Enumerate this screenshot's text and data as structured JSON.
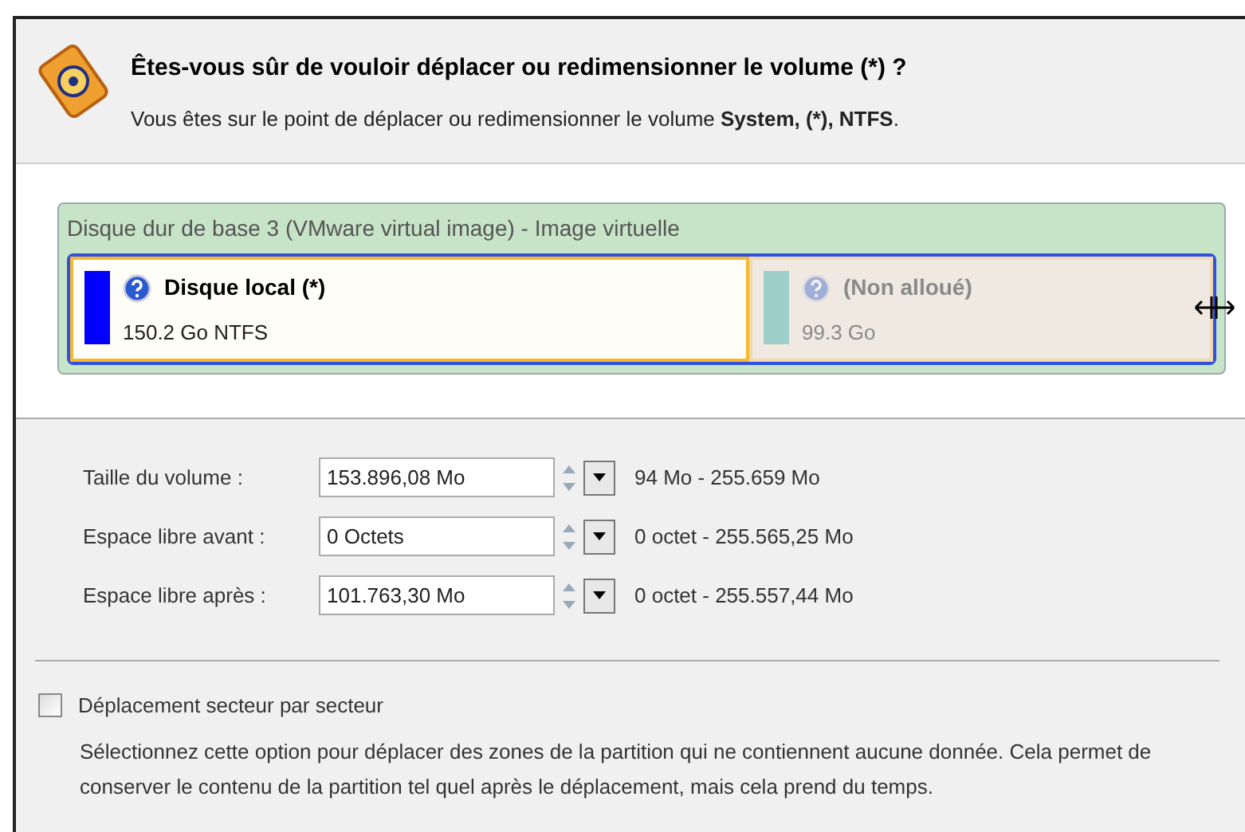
{
  "header": {
    "title": "Êtes-vous sûr de vouloir déplacer ou redimensionner le volume (*) ?",
    "subtitle": "Vous êtes sur le point de déplacer ou redimensionner le volume **System, (*), NTFS**."
  },
  "disk": {
    "title": "Disque dur de base 3 (VMware virtual image) - Image virtuelle",
    "partitions": [
      {
        "name": "Disque local (*)",
        "info": "150.2 Go NTFS",
        "color": "#0000ff",
        "kind": "volume",
        "selected": true
      },
      {
        "name": "(Non alloué)",
        "info": "99.3 Go",
        "color": "#9ecfc8",
        "kind": "unallocated",
        "selected": false
      }
    ]
  },
  "fields": [
    {
      "label": "Taille du volume :",
      "value": "153.896,08 Mo",
      "range": "94 Mo - 255.659 Mo"
    },
    {
      "label": "Espace libre avant :",
      "value": "0 Octets",
      "range": "0 octet - 255.565,25 Mo"
    },
    {
      "label": "Espace libre après :",
      "value": "101.763,30 Mo",
      "range": "0 octet - 255.557,44 Mo"
    }
  ],
  "option": {
    "label": "Déplacement secteur par secteur",
    "checked": false,
    "description": "Sélectionnez cette option pour déplacer des zones de la partition qui ne contiennent aucune donnée. Cela permet de conserver le contenu de la partition tel quel après le déplacement, mais cela prend du temps."
  }
}
